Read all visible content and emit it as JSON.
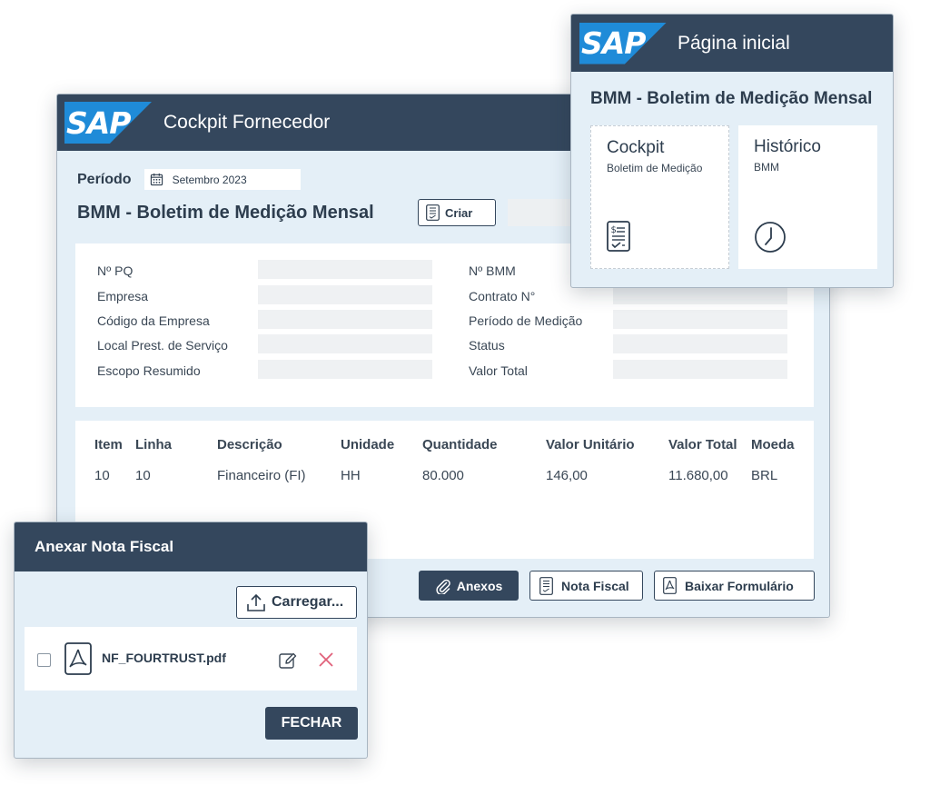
{
  "main": {
    "logo_text": "SAP",
    "title": "Cockpit Fornecedor",
    "period_label": "Período",
    "period_value": "Setembro 2023",
    "bmm_title": "BMM - Boletim de Medição Mensal",
    "criar_label": "Criar",
    "fields_left": [
      {
        "label": "Nº PQ",
        "value": ""
      },
      {
        "label": "Empresa",
        "value": ""
      },
      {
        "label": "Código da Empresa",
        "value": ""
      },
      {
        "label": "Local Prest. de Serviço",
        "value": ""
      },
      {
        "label": "Escopo Resumido",
        "value": ""
      }
    ],
    "fields_right": [
      {
        "label": "Nº BMM",
        "value": ""
      },
      {
        "label": "Contrato N°",
        "value": ""
      },
      {
        "label": "Período de Medição",
        "value": ""
      },
      {
        "label": "Status",
        "value": ""
      },
      {
        "label": "Valor Total",
        "value": ""
      }
    ],
    "table": {
      "columns": [
        "Item",
        "Linha",
        "Descrição",
        "Unidade",
        "Quantidade",
        "Valor Unitário",
        "Valor Total",
        "Moeda"
      ],
      "rows": [
        [
          "10",
          "10",
          "Financeiro (FI)",
          "HH",
          "80.000",
          "146,00",
          "11.680,00",
          "BRL"
        ]
      ]
    },
    "buttons": {
      "anexos": "Anexos",
      "nota_fiscal": "Nota Fiscal",
      "baixar": "Baixar Formulário"
    }
  },
  "home": {
    "logo_text": "SAP",
    "title": "Página inicial",
    "subtitle": "BMM - Boletim de Medição Mensal",
    "tiles": [
      {
        "title": "Cockpit",
        "subtitle": "Boletim de Medição",
        "icon": "document-checklist-icon"
      },
      {
        "title": "Histórico",
        "subtitle": "BMM",
        "icon": "clock-icon"
      }
    ]
  },
  "attach": {
    "title": "Anexar Nota Fiscal",
    "upload_label": "Carregar...",
    "files": [
      {
        "name": "NF_FOURTRUST.pdf",
        "checked": false
      }
    ],
    "close_label": "FECHAR"
  },
  "colors": {
    "titlebar": "#34475d",
    "window_bg": "#e4eff7",
    "sap_blue": "#1f8bd8",
    "delete": "#e0607a"
  }
}
